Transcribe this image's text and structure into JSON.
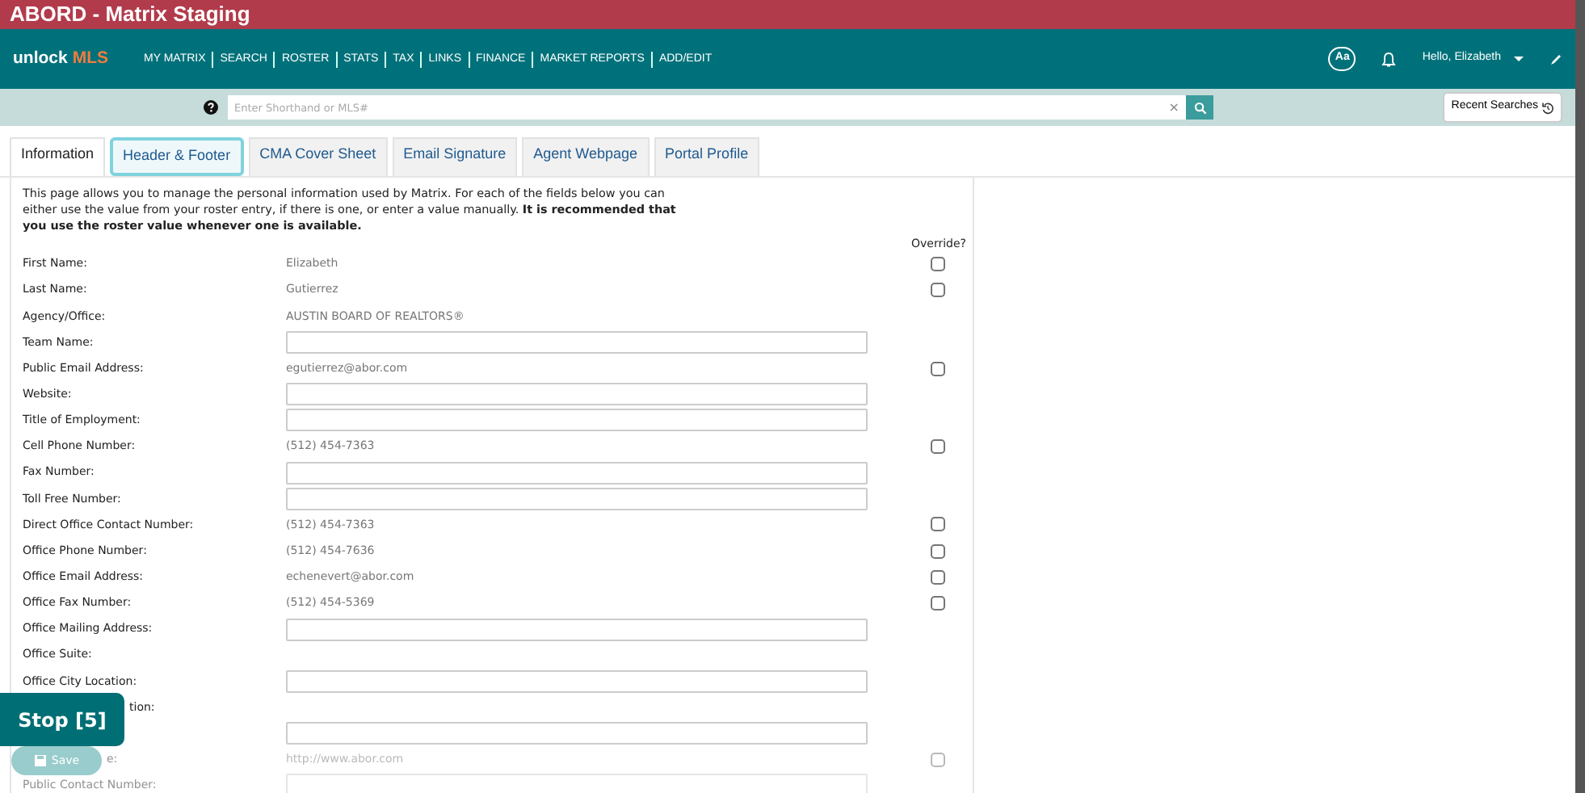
{
  "window": {
    "title": "ABORD - Matrix Staging"
  },
  "navbar": {
    "logo": {
      "part_1": "unlock",
      "part_2": "MLS"
    },
    "menu": [
      "MY MATRIX",
      "SEARCH",
      "ROSTER",
      "STATS",
      "TAX",
      "LINKS",
      "FINANCE",
      "MARKET REPORTS",
      "ADD/EDIT"
    ],
    "text_size_button": "Aa",
    "user_menu": "Hello, Elizabeth"
  },
  "search": {
    "placeholder": "Enter Shorthand or MLS#",
    "clear": "×",
    "recent_button": "Recent Searches"
  },
  "tabs": [
    {
      "label": "Information",
      "selected": true,
      "focused": false
    },
    {
      "label": "Header & Footer",
      "selected": false,
      "focused": true
    },
    {
      "label": "CMA Cover Sheet",
      "selected": false,
      "focused": false
    },
    {
      "label": "Email Signature",
      "selected": false,
      "focused": false
    },
    {
      "label": "Agent Webpage",
      "selected": false,
      "focused": false
    },
    {
      "label": "Portal Profile",
      "selected": false,
      "focused": false
    }
  ],
  "intro": "This page allows you to manage the personal information used by Matrix. For each of the fields below you can either use the value from your roster entry, if there is one, or enter a value manually. **It is recommended that you use the roster value whenever one is available.**",
  "override_heading": "Override?",
  "fields": [
    {
      "label": "First Name:",
      "kind": "roster",
      "value": "Elizabeth",
      "override": false
    },
    {
      "label": "Last Name:",
      "kind": "roster",
      "value": "Gutierrez",
      "override": false
    },
    {
      "label": "Agency/Office:",
      "kind": "roster",
      "value": "AUSTIN BOARD OF REALTORS®"
    },
    {
      "label": "Team Name:",
      "kind": "input"
    },
    {
      "label": "Public Email Address:",
      "kind": "roster",
      "value": "egutierrez@abor.com",
      "override": false
    },
    {
      "label": "Website:",
      "kind": "input"
    },
    {
      "label": "Title of Employment:",
      "kind": "input"
    },
    {
      "label": "Cell Phone Number:",
      "kind": "roster",
      "value": "(512) 454-7363",
      "override": false
    },
    {
      "label": "Fax Number:",
      "kind": "input"
    },
    {
      "label": "Toll Free Number:",
      "kind": "input"
    },
    {
      "label": "Direct Office Contact Number:",
      "kind": "roster",
      "value": "(512) 454-7363",
      "override": false
    },
    {
      "label": "Office Phone Number:",
      "kind": "roster",
      "value": "(512) 454-7636",
      "override": false
    },
    {
      "label": "Office Email Address:",
      "kind": "roster",
      "value": "echenevert@abor.com",
      "override": false
    },
    {
      "label": "Office Fax Number:",
      "kind": "roster",
      "value": "(512) 454-5369",
      "override": false
    },
    {
      "label": "Office Mailing Address:",
      "kind": "input"
    },
    {
      "label": "Office Suite:",
      "kind": "blank"
    },
    {
      "label": "Office City Location:",
      "kind": "input"
    },
    {
      "label": "tion:",
      "kind": "blank"
    },
    {
      "kind": "input"
    },
    {
      "label": "e:",
      "kind": "roster",
      "value": "http://www.abor.com",
      "override": false
    },
    {
      "label": "Public Contact Number:",
      "kind": "input"
    }
  ],
  "save_button": "Save",
  "stop_button": "Stop [5]"
}
